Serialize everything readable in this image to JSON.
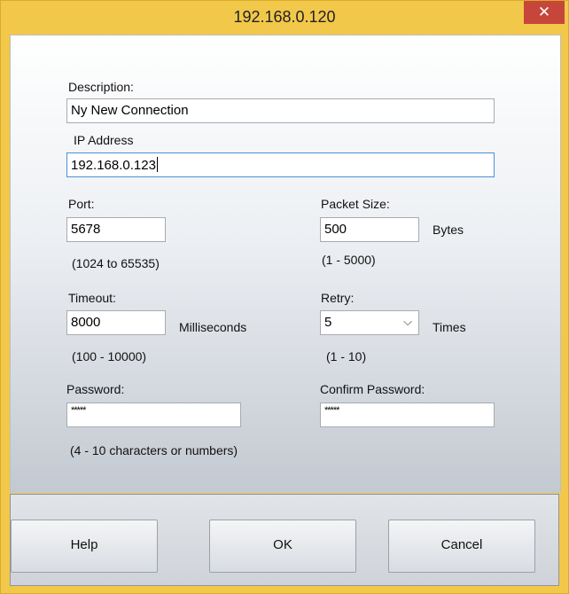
{
  "window": {
    "title": "192.168.0.120",
    "close_icon": "close-icon ✕"
  },
  "description": {
    "label": "Description:",
    "value": "Ny New Connection"
  },
  "ip": {
    "label": "IP Address",
    "value": "192.168.0.123"
  },
  "port": {
    "label": "Port:",
    "value": "5678",
    "range": "(1024 to 65535)"
  },
  "packet_size": {
    "label": "Packet Size:",
    "value": "500",
    "unit": "Bytes",
    "range": "(1 - 5000)"
  },
  "timeout": {
    "label": "Timeout:",
    "value": "8000",
    "unit": "Milliseconds",
    "range": "(100 - 10000)"
  },
  "retry": {
    "label": "Retry:",
    "value": "5",
    "unit": "Times",
    "range": "(1 - 10)"
  },
  "password": {
    "label": "Password:",
    "value": "*****",
    "hint": "(4 - 10 characters or numbers)"
  },
  "confirm_password": {
    "label": "Confirm Password:",
    "value": "*****"
  },
  "buttons": {
    "help": "Help",
    "ok": "OK",
    "cancel": "Cancel"
  }
}
